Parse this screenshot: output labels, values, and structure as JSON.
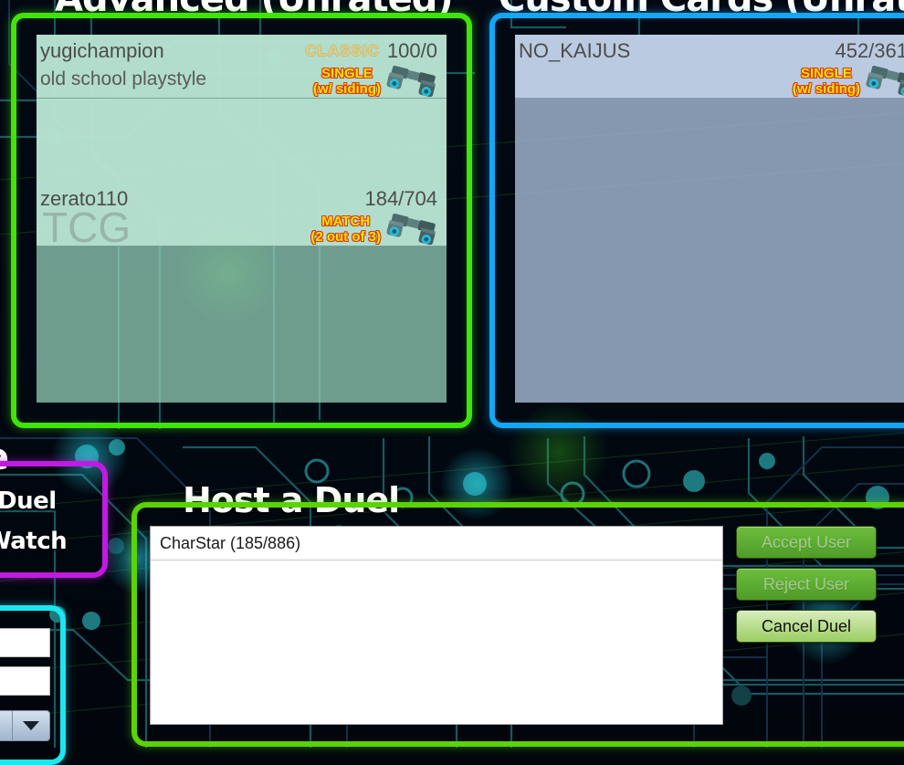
{
  "panels": {
    "advanced": {
      "title": "Advanced (Unrated)",
      "border_color": "#41e409",
      "duels": [
        {
          "host": "yugichampion",
          "score": "100/0",
          "badge": "CLASSIC",
          "tagline": "old school playstyle",
          "mode_line1": "SINGLE",
          "mode_line2": "(w/ siding)",
          "spectate_icon": "binoculars-icon",
          "watermark": ""
        },
        {
          "host": "zerato110",
          "score": "184/704",
          "badge": "",
          "tagline": "",
          "mode_line1": "MATCH",
          "mode_line2": "(2 out of 3)",
          "spectate_icon": "binoculars-icon",
          "watermark": "TCG"
        }
      ]
    },
    "custom_cards": {
      "title": "Custom Cards (Unrated)",
      "border_color": "#13a7f5",
      "duels": [
        {
          "host": "NO_KAIJUS",
          "score": "452/361",
          "badge": "",
          "tagline": "",
          "mode_line1": "SINGLE",
          "mode_line2": "(w/ siding)",
          "spectate_icon": "binoculars-icon",
          "watermark": ""
        }
      ]
    },
    "mode": {
      "title": "Mode",
      "border_color": "#c11ae0",
      "options": [
        {
          "label": "Duel"
        },
        {
          "label": "Watch"
        }
      ]
    },
    "filters": {
      "border_color": "#19e8f0",
      "field1_value": "",
      "field2_value": "",
      "combo_value": "",
      "caret_icon": "chevron-down-icon"
    },
    "host_a_duel": {
      "title": "Host a Duel",
      "border_color": "#5ad307",
      "requests": [
        {
          "label": "CharStar (185/886)"
        }
      ],
      "buttons": [
        {
          "label": "Accept User",
          "state": "disabled"
        },
        {
          "label": "Reject User",
          "state": "disabled"
        },
        {
          "label": "Cancel Duel",
          "state": "enabled"
        }
      ]
    }
  }
}
